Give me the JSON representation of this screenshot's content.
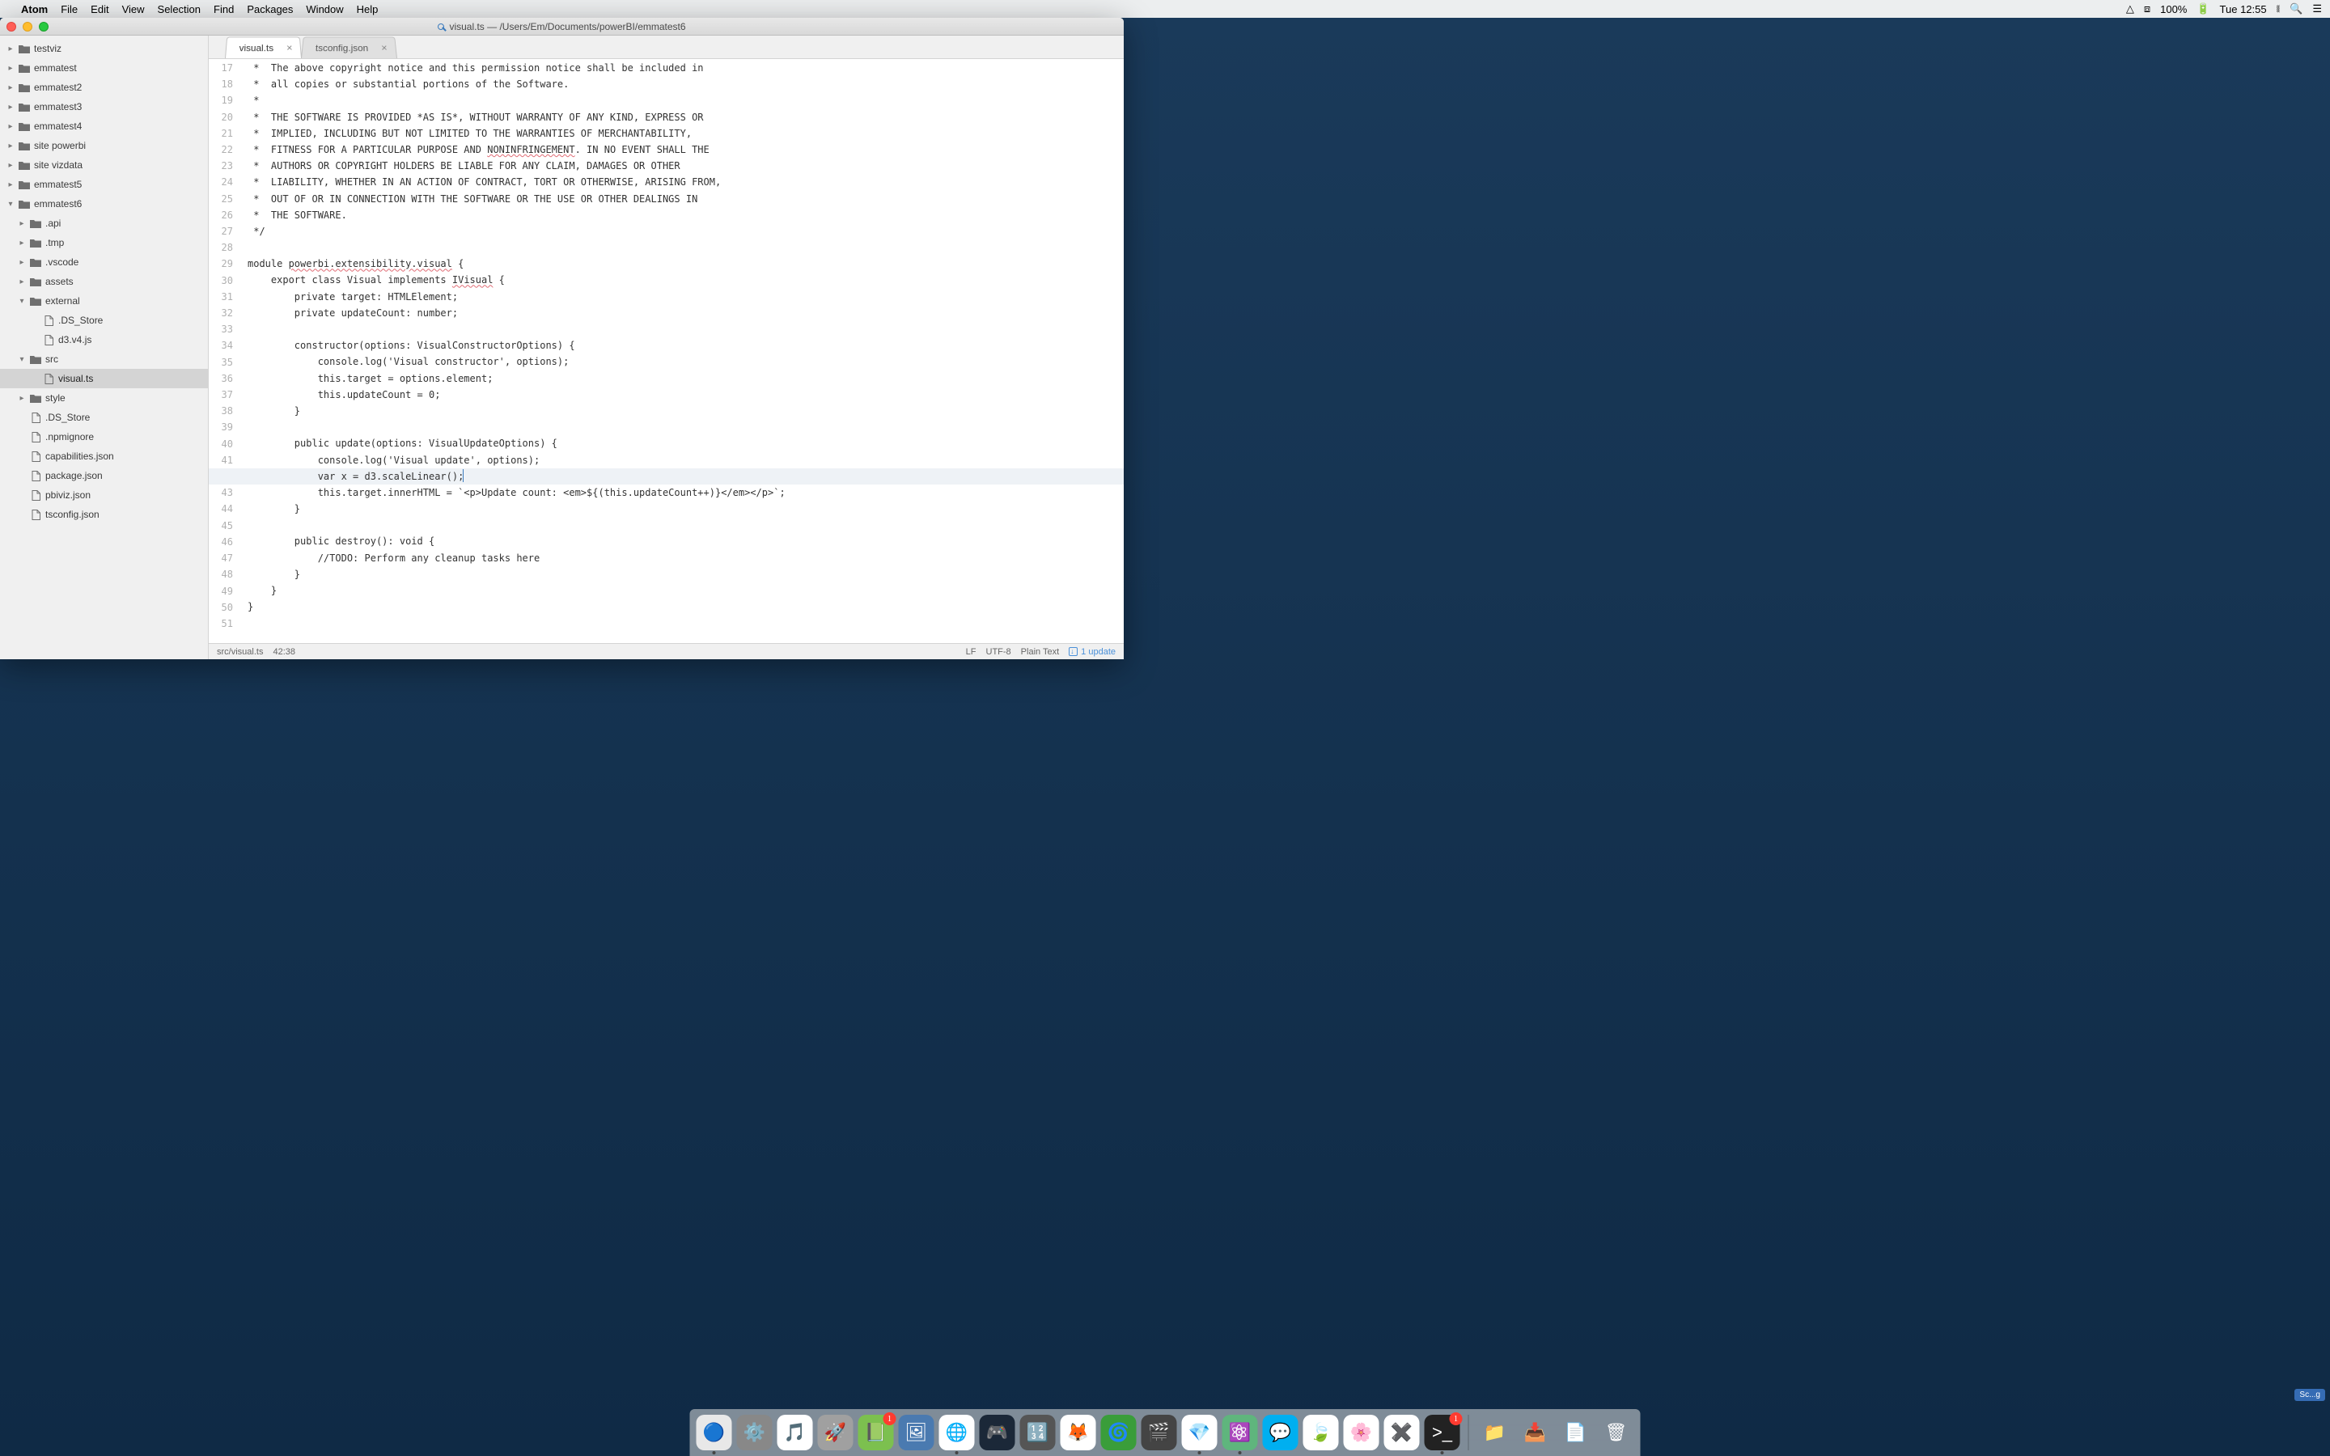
{
  "menubar": {
    "app": "Atom",
    "items": [
      "File",
      "Edit",
      "View",
      "Selection",
      "Find",
      "Packages",
      "Window",
      "Help"
    ],
    "battery": "100%",
    "clock": "Tue 12:55"
  },
  "window": {
    "title": "visual.ts — /Users/Em/Documents/powerBI/emmatest6"
  },
  "tree": [
    {
      "depth": 0,
      "chev": "▸",
      "type": "folder",
      "name": "testviz"
    },
    {
      "depth": 0,
      "chev": "▸",
      "type": "folder",
      "name": "emmatest"
    },
    {
      "depth": 0,
      "chev": "▸",
      "type": "folder",
      "name": "emmatest2"
    },
    {
      "depth": 0,
      "chev": "▸",
      "type": "folder",
      "name": "emmatest3"
    },
    {
      "depth": 0,
      "chev": "▸",
      "type": "folder",
      "name": "emmatest4"
    },
    {
      "depth": 0,
      "chev": "▸",
      "type": "folder",
      "name": "site powerbi"
    },
    {
      "depth": 0,
      "chev": "▸",
      "type": "folder",
      "name": "site vizdata"
    },
    {
      "depth": 0,
      "chev": "▸",
      "type": "folder",
      "name": "emmatest5"
    },
    {
      "depth": 0,
      "chev": "▾",
      "type": "folder",
      "name": "emmatest6"
    },
    {
      "depth": 1,
      "chev": "▸",
      "type": "folder",
      "name": ".api"
    },
    {
      "depth": 1,
      "chev": "▸",
      "type": "folder",
      "name": ".tmp"
    },
    {
      "depth": 1,
      "chev": "▸",
      "type": "folder",
      "name": ".vscode"
    },
    {
      "depth": 1,
      "chev": "▸",
      "type": "folder",
      "name": "assets"
    },
    {
      "depth": 1,
      "chev": "▾",
      "type": "folder",
      "name": "external"
    },
    {
      "depth": 2,
      "chev": "",
      "type": "file",
      "name": ".DS_Store"
    },
    {
      "depth": 2,
      "chev": "",
      "type": "file",
      "name": "d3.v4.js"
    },
    {
      "depth": 1,
      "chev": "▾",
      "type": "folder",
      "name": "src"
    },
    {
      "depth": 2,
      "chev": "",
      "type": "file",
      "name": "visual.ts",
      "selected": true
    },
    {
      "depth": 1,
      "chev": "▸",
      "type": "folder",
      "name": "style"
    },
    {
      "depth": 1,
      "chev": "",
      "type": "file",
      "name": ".DS_Store"
    },
    {
      "depth": 1,
      "chev": "",
      "type": "file",
      "name": ".npmignore"
    },
    {
      "depth": 1,
      "chev": "",
      "type": "file",
      "name": "capabilities.json"
    },
    {
      "depth": 1,
      "chev": "",
      "type": "file",
      "name": "package.json"
    },
    {
      "depth": 1,
      "chev": "",
      "type": "file",
      "name": "pbiviz.json"
    },
    {
      "depth": 1,
      "chev": "",
      "type": "file",
      "name": "tsconfig.json"
    }
  ],
  "tabs": [
    {
      "label": "visual.ts",
      "active": true
    },
    {
      "label": "tsconfig.json",
      "active": false
    }
  ],
  "code": {
    "start": 17,
    "highlight": 42,
    "lines": [
      " *  The above copyright notice and this permission notice shall be included in",
      " *  all copies or substantial portions of the Software.",
      " *",
      " *  THE SOFTWARE IS PROVIDED *AS IS*, WITHOUT WARRANTY OF ANY KIND, EXPRESS OR",
      " *  IMPLIED, INCLUDING BUT NOT LIMITED TO THE WARRANTIES OF MERCHANTABILITY,",
      " *  FITNESS FOR A PARTICULAR PURPOSE AND <wavy>NONINFRINGEMENT</wavy>. IN NO EVENT SHALL THE",
      " *  AUTHORS OR COPYRIGHT HOLDERS BE LIABLE FOR ANY CLAIM, DAMAGES OR OTHER",
      " *  LIABILITY, WHETHER IN AN ACTION OF CONTRACT, TORT OR OTHERWISE, ARISING FROM,",
      " *  OUT OF OR IN CONNECTION WITH THE SOFTWARE OR THE USE OR OTHER DEALINGS IN",
      " *  THE SOFTWARE.",
      " */",
      "",
      "module <wavy>powerbi.extensibility.visual</wavy> {",
      "    export class Visual implements <wavy>IVisual</wavy> {",
      "        private target: HTMLElement;",
      "        private updateCount: number;",
      "",
      "        constructor(options: VisualConstructorOptions) {",
      "            console.log('Visual constructor', options);",
      "            this.target = options.element;",
      "            this.updateCount = 0;",
      "        }",
      "",
      "        public update(options: VisualUpdateOptions) {",
      "            console.log('Visual update', options);",
      "            var x = d3.scaleLinear();<cursor/>",
      "            this.target.innerHTML = `<p>Update count: <em>${(this.updateCount++)}</em></p>`;",
      "        }",
      "",
      "        public destroy(): void {",
      "            //TODO: Perform any cleanup tasks here",
      "        }",
      "    }",
      "}",
      ""
    ]
  },
  "status": {
    "path": "src/visual.ts",
    "pos": "42:38",
    "eol": "LF",
    "enc": "UTF-8",
    "lang": "Plain Text",
    "update": "1 update"
  },
  "dock": [
    {
      "name": "finder",
      "emoji": "🔵",
      "bg": "#e8e8e8",
      "dot": true
    },
    {
      "name": "settings",
      "emoji": "⚙️",
      "bg": "#888"
    },
    {
      "name": "itunes",
      "emoji": "🎵",
      "bg": "#fff"
    },
    {
      "name": "launchpad",
      "emoji": "🚀",
      "bg": "#a0a0a0"
    },
    {
      "name": "evernote",
      "emoji": "📗",
      "bg": "#7cc04f",
      "badge": "1"
    },
    {
      "name": "preview",
      "emoji": "🖼",
      "bg": "#4a7ab0"
    },
    {
      "name": "chrome",
      "emoji": "🌐",
      "bg": "#fff",
      "dot": true
    },
    {
      "name": "steam",
      "emoji": "🎮",
      "bg": "#1b2838"
    },
    {
      "name": "calculator",
      "emoji": "🔢",
      "bg": "#555"
    },
    {
      "name": "firefox",
      "emoji": "🦊",
      "bg": "#fff"
    },
    {
      "name": "torrent",
      "emoji": "🌀",
      "bg": "#3a9d3a"
    },
    {
      "name": "imovie",
      "emoji": "🎬",
      "bg": "#444"
    },
    {
      "name": "sketch",
      "emoji": "💎",
      "bg": "#fff",
      "dot": true
    },
    {
      "name": "atom",
      "emoji": "⚛️",
      "bg": "#5fb57d",
      "dot": true
    },
    {
      "name": "skype",
      "emoji": "💬",
      "bg": "#00aff0"
    },
    {
      "name": "fresh",
      "emoji": "🍃",
      "bg": "#fff"
    },
    {
      "name": "photos",
      "emoji": "🌸",
      "bg": "#fff"
    },
    {
      "name": "excel",
      "emoji": "✖️",
      "bg": "#fff"
    },
    {
      "name": "terminal",
      "emoji": ">_",
      "bg": "#222",
      "badge": "1",
      "dot": true
    },
    {
      "sep": true
    },
    {
      "name": "folder",
      "emoji": "📁",
      "bg": "transparent"
    },
    {
      "name": "downloads",
      "emoji": "📥",
      "bg": "transparent"
    },
    {
      "name": "docs",
      "emoji": "📄",
      "bg": "transparent"
    },
    {
      "name": "trash",
      "emoji": "🗑",
      "bg": "transparent"
    }
  ],
  "desktop_label": "Sc...g"
}
